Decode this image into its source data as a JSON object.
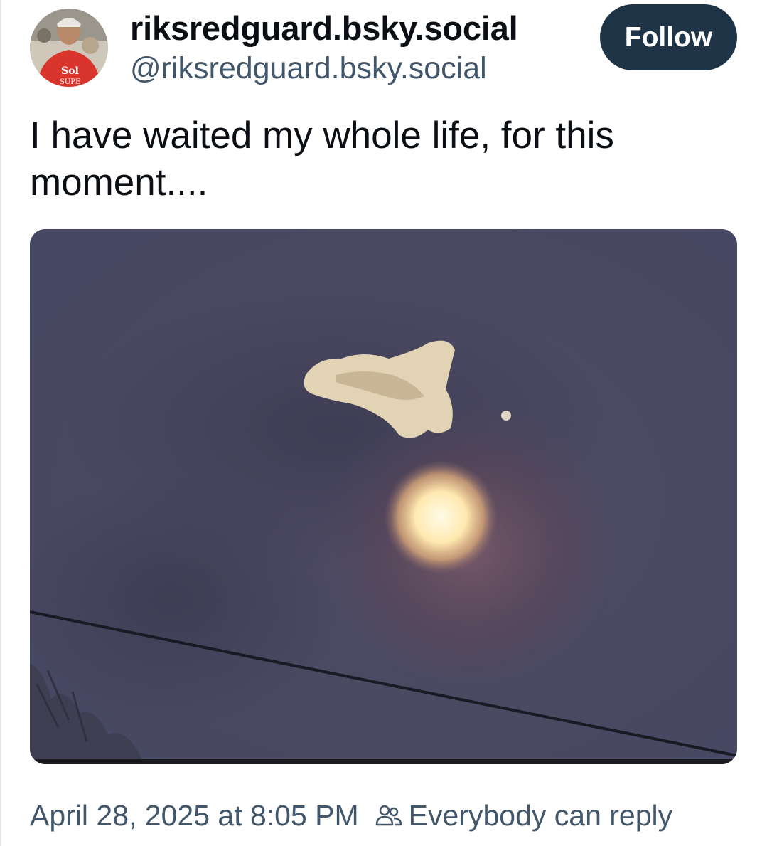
{
  "author": {
    "display_name": "riksredguard.bsky.social",
    "handle": "@riksredguard.bsky.social",
    "avatar_icon": "avatar-photo"
  },
  "follow_button": {
    "label": "Follow"
  },
  "post": {
    "text": "I have waited my whole life, for this moment....",
    "image_icon": "moon-cloud-photo"
  },
  "meta": {
    "timestamp": "April 28, 2025 at 8:05 PM",
    "reply_icon": "people-icon",
    "reply_setting": "Everybody can reply"
  },
  "colors": {
    "follow_bg": "#1f3447",
    "secondary_text": "#42576c",
    "primary_text": "#0b0f14"
  }
}
